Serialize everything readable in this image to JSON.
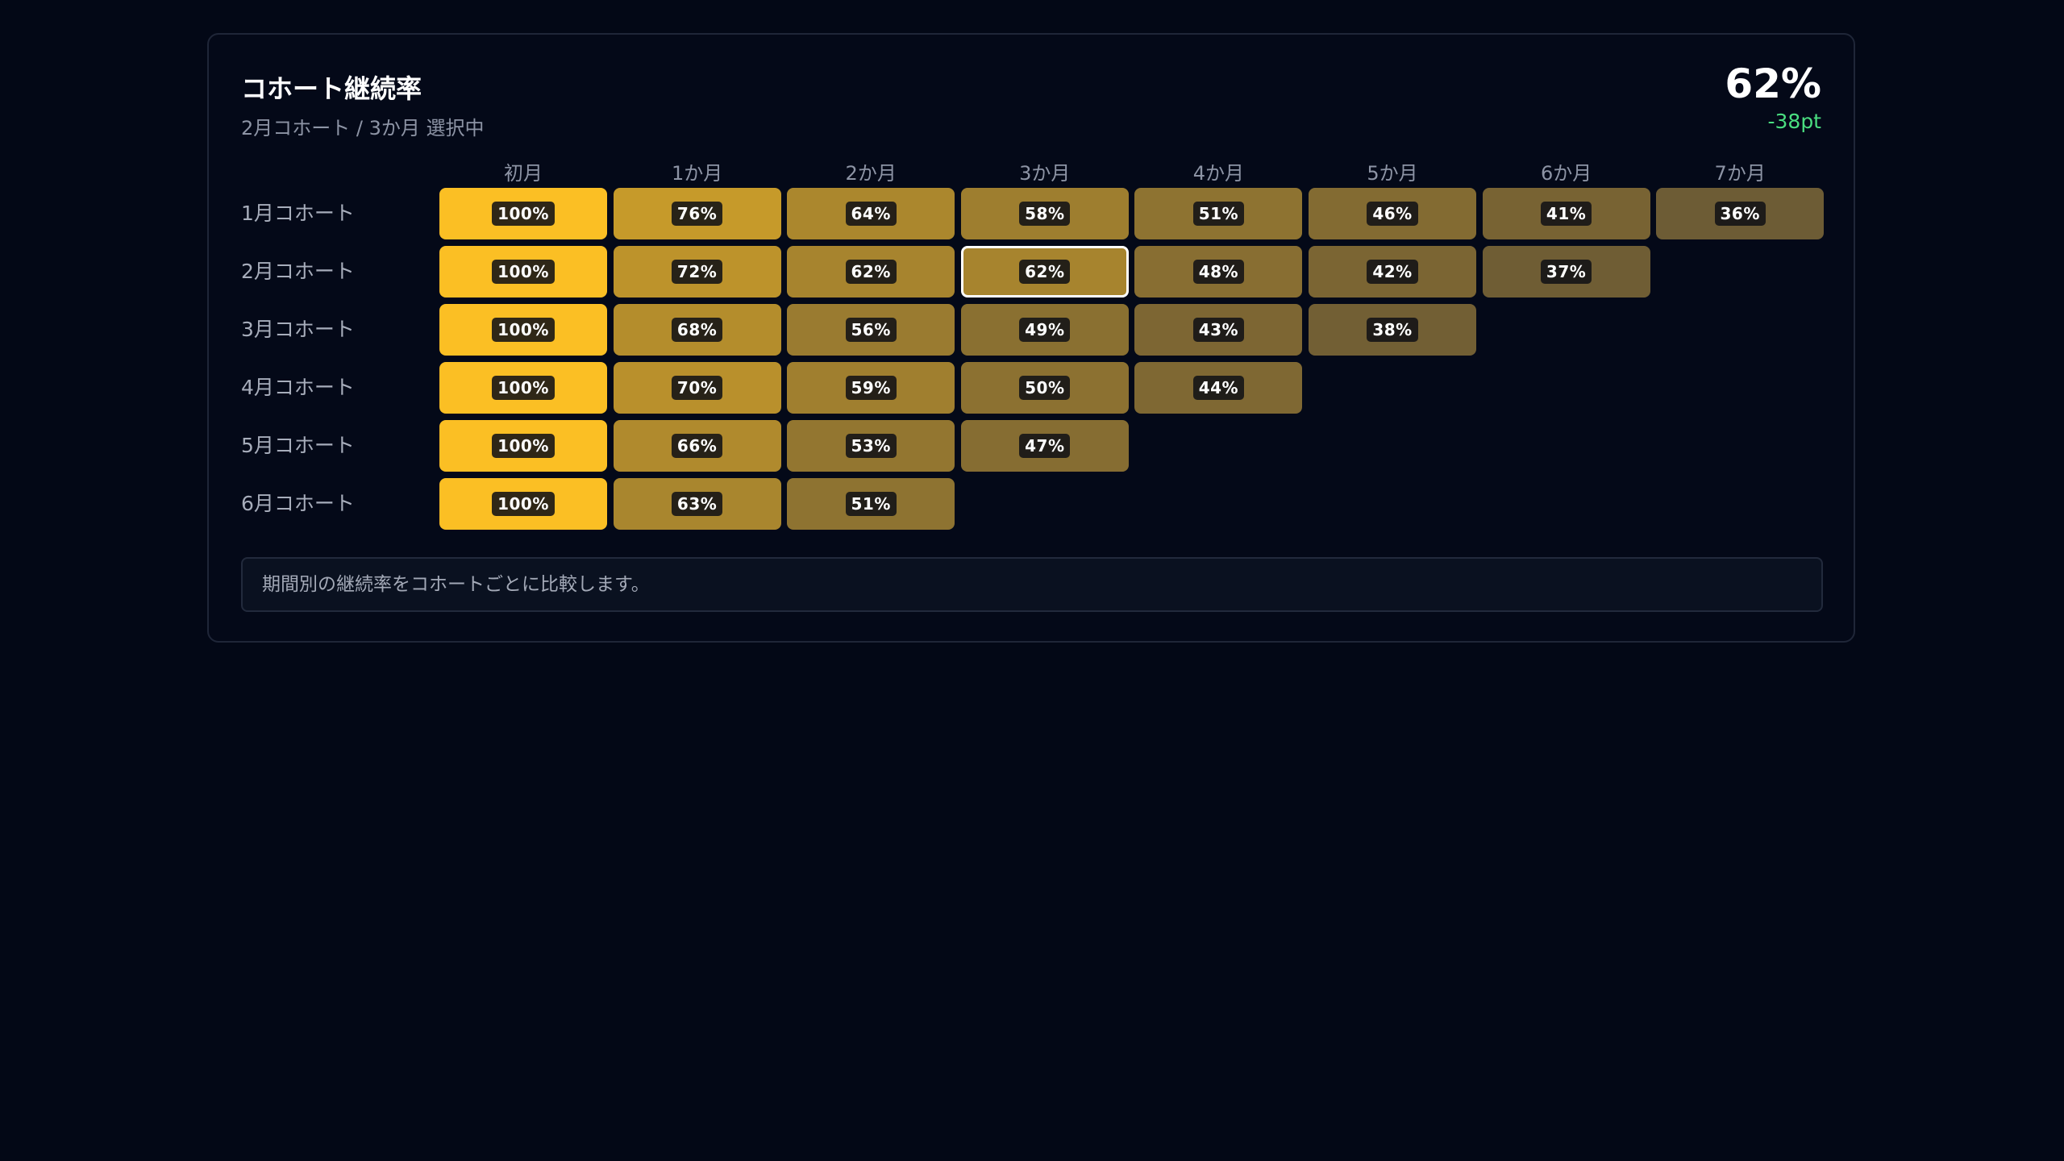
{
  "header": {
    "title": "コホート継続率",
    "subtitle": "2月コホート / 3か月 選択中",
    "metric_value": "62%",
    "metric_delta": "-38pt",
    "delta_color": "#4ade80"
  },
  "columns": [
    "初月",
    "1か月",
    "2か月",
    "3か月",
    "4か月",
    "5か月",
    "6か月",
    "7か月"
  ],
  "rows": [
    {
      "label": "1月コホート",
      "values": [
        100,
        76,
        64,
        58,
        51,
        46,
        41,
        36
      ]
    },
    {
      "label": "2月コホート",
      "values": [
        100,
        72,
        62,
        62,
        48,
        42,
        37
      ]
    },
    {
      "label": "3月コホート",
      "values": [
        100,
        68,
        56,
        49,
        43,
        38
      ]
    },
    {
      "label": "4月コホート",
      "values": [
        100,
        70,
        59,
        50,
        44
      ]
    },
    {
      "label": "5月コホート",
      "values": [
        100,
        66,
        53,
        47
      ]
    },
    {
      "label": "6月コホート",
      "values": [
        100,
        63,
        51
      ]
    }
  ],
  "selected": {
    "row": 1,
    "col": 3
  },
  "note": "期間別の継続率をコホートごとに比較します。",
  "colors": {
    "high": "#fbbf24",
    "low": "#6b5a35",
    "background": "#030816"
  }
}
